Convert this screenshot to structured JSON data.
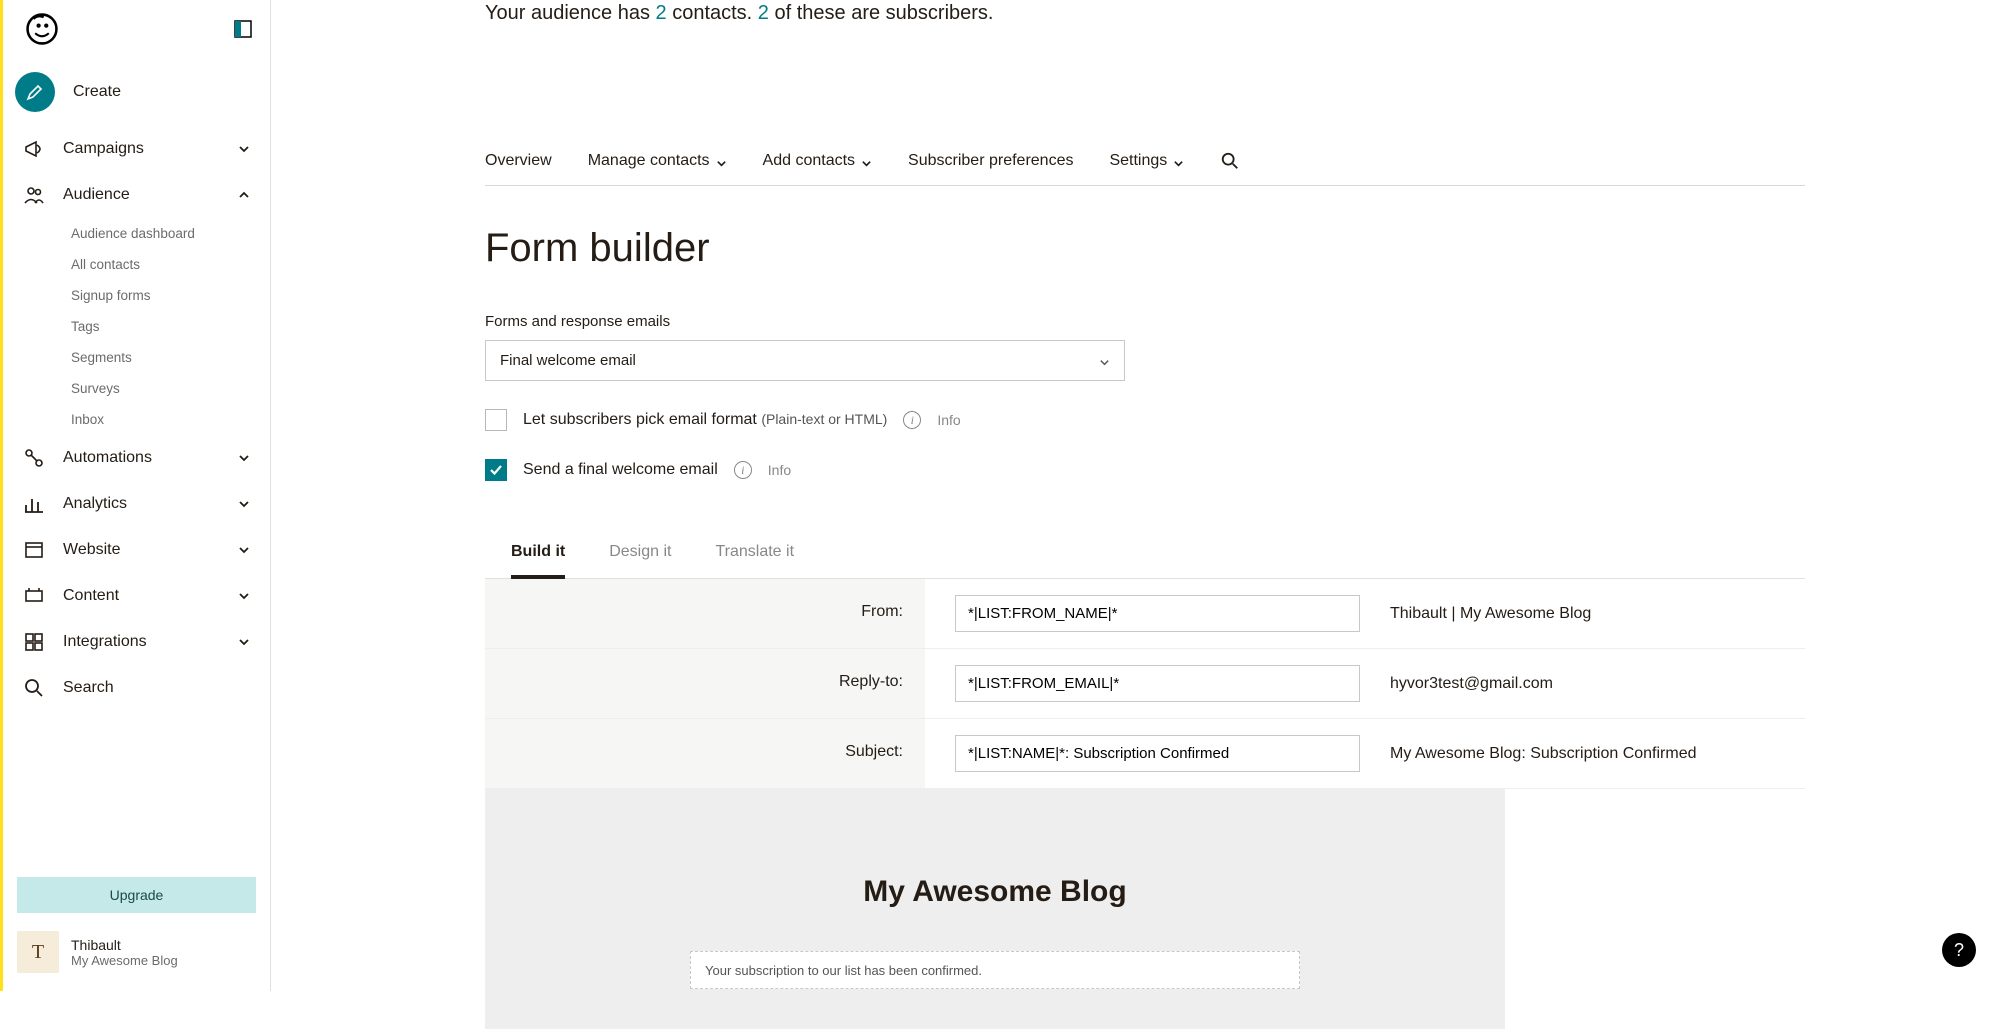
{
  "sidebar": {
    "create_label": "Create",
    "campaigns": "Campaigns",
    "audience": "Audience",
    "automations": "Automations",
    "analytics": "Analytics",
    "website": "Website",
    "content": "Content",
    "integrations": "Integrations",
    "search": "Search",
    "subnav": {
      "dashboard": "Audience dashboard",
      "all_contacts": "All contacts",
      "signup_forms": "Signup forms",
      "tags": "Tags",
      "segments": "Segments",
      "surveys": "Surveys",
      "inbox": "Inbox"
    },
    "upgrade": "Upgrade",
    "user_initial": "T",
    "user_name": "Thibault",
    "user_sub": "My Awesome Blog"
  },
  "audience_line": {
    "pre": "Your audience has ",
    "count1": "2",
    "mid": " contacts. ",
    "count2": "2",
    "post": " of these are subscribers."
  },
  "tabs": {
    "overview": "Overview",
    "manage_contacts": "Manage contacts",
    "add_contacts": "Add contacts",
    "subscriber_prefs": "Subscriber preferences",
    "settings": "Settings"
  },
  "page_title": "Form builder",
  "forms_label": "Forms and response emails",
  "select_value": "Final welcome email",
  "check1": {
    "label": "Let subscribers pick email format ",
    "hint": "(Plain-text or HTML)",
    "info": "Info"
  },
  "check2": {
    "label": "Send a final welcome email",
    "info": "Info"
  },
  "builder_tabs": {
    "build": "Build it",
    "design": "Design it",
    "translate": "Translate it"
  },
  "fields": {
    "from_label": "From:",
    "from_value": "*|LIST:FROM_NAME|*",
    "from_resolved": "Thibault | My Awesome Blog",
    "reply_label": "Reply-to:",
    "reply_value": "*|LIST:FROM_EMAIL|*",
    "reply_resolved": "hyvor3test@gmail.com",
    "subject_label": "Subject:",
    "subject_value": "*|LIST:NAME|*: Subscription Confirmed",
    "subject_resolved": "My Awesome Blog: Subscription Confirmed"
  },
  "preview": {
    "title": "My Awesome Blog",
    "message": "Your subscription to our list has been confirmed."
  },
  "help": "?"
}
